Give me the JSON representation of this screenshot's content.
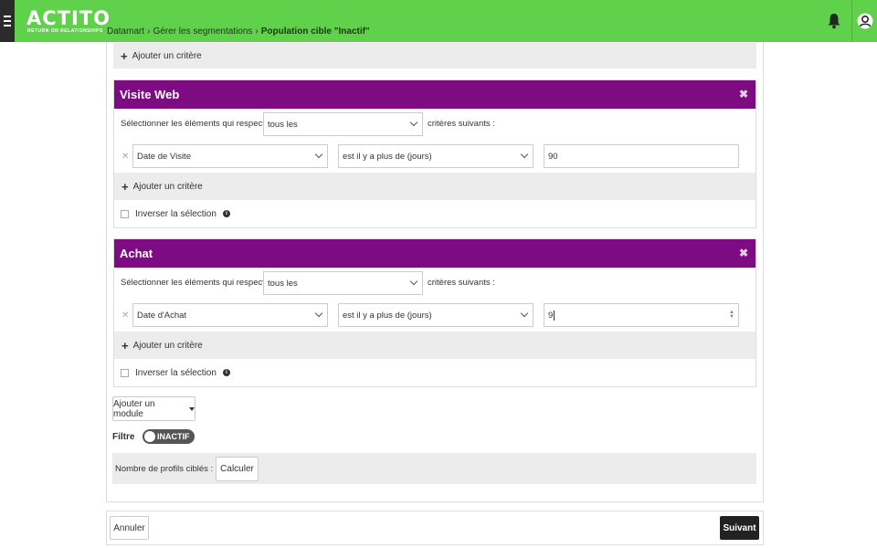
{
  "header": {
    "logo": "ACTITO",
    "tagline": "RETURN ON RELATIONSHIPS",
    "breadcrumb": [
      "Datamart",
      "Gérer les segmentations",
      "Population cible \"Inactif\""
    ],
    "breadcrumb_sep": "›",
    "bell_icon": "bell-icon",
    "user_icon": "user-avatar-icon",
    "bar_color": "#5fd14a"
  },
  "top_add_criterion": "Ajouter un critère",
  "modules": [
    {
      "title": "Visite Web",
      "close": "✖",
      "select_label": "Sélectionner les éléments qui respectent",
      "match_value": "tous les",
      "criteria_suffix": "critères suivants :",
      "criterion": {
        "remove": "✕",
        "field": "Date de Visite",
        "operator": "est il y a plus de (jours)",
        "value": "90"
      },
      "add_criterion": "Ajouter un critère",
      "invert_label": "Inverser la sélection",
      "info": "i"
    },
    {
      "title": "Achat",
      "close": "✖",
      "select_label": "Sélectionner les éléments qui respectent",
      "match_value": "tous les",
      "criteria_suffix": "critères suivants :",
      "criterion": {
        "remove": "✕",
        "field": "Date d'Achat",
        "operator": "est il y a plus de (jours)",
        "value": "9"
      },
      "add_criterion": "Ajouter un critère",
      "invert_label": "Inverser la sélection",
      "info": "i"
    }
  ],
  "module_color": "#7d0c83",
  "add_module": "Ajouter un module",
  "filter": {
    "label": "Filtre",
    "toggle_state": "INACTIF"
  },
  "profiles": {
    "label": "Nombre de profils ciblés : -",
    "calc_button": "Calculer"
  },
  "footer": {
    "cancel": "Annuler",
    "next": "Suivant"
  }
}
